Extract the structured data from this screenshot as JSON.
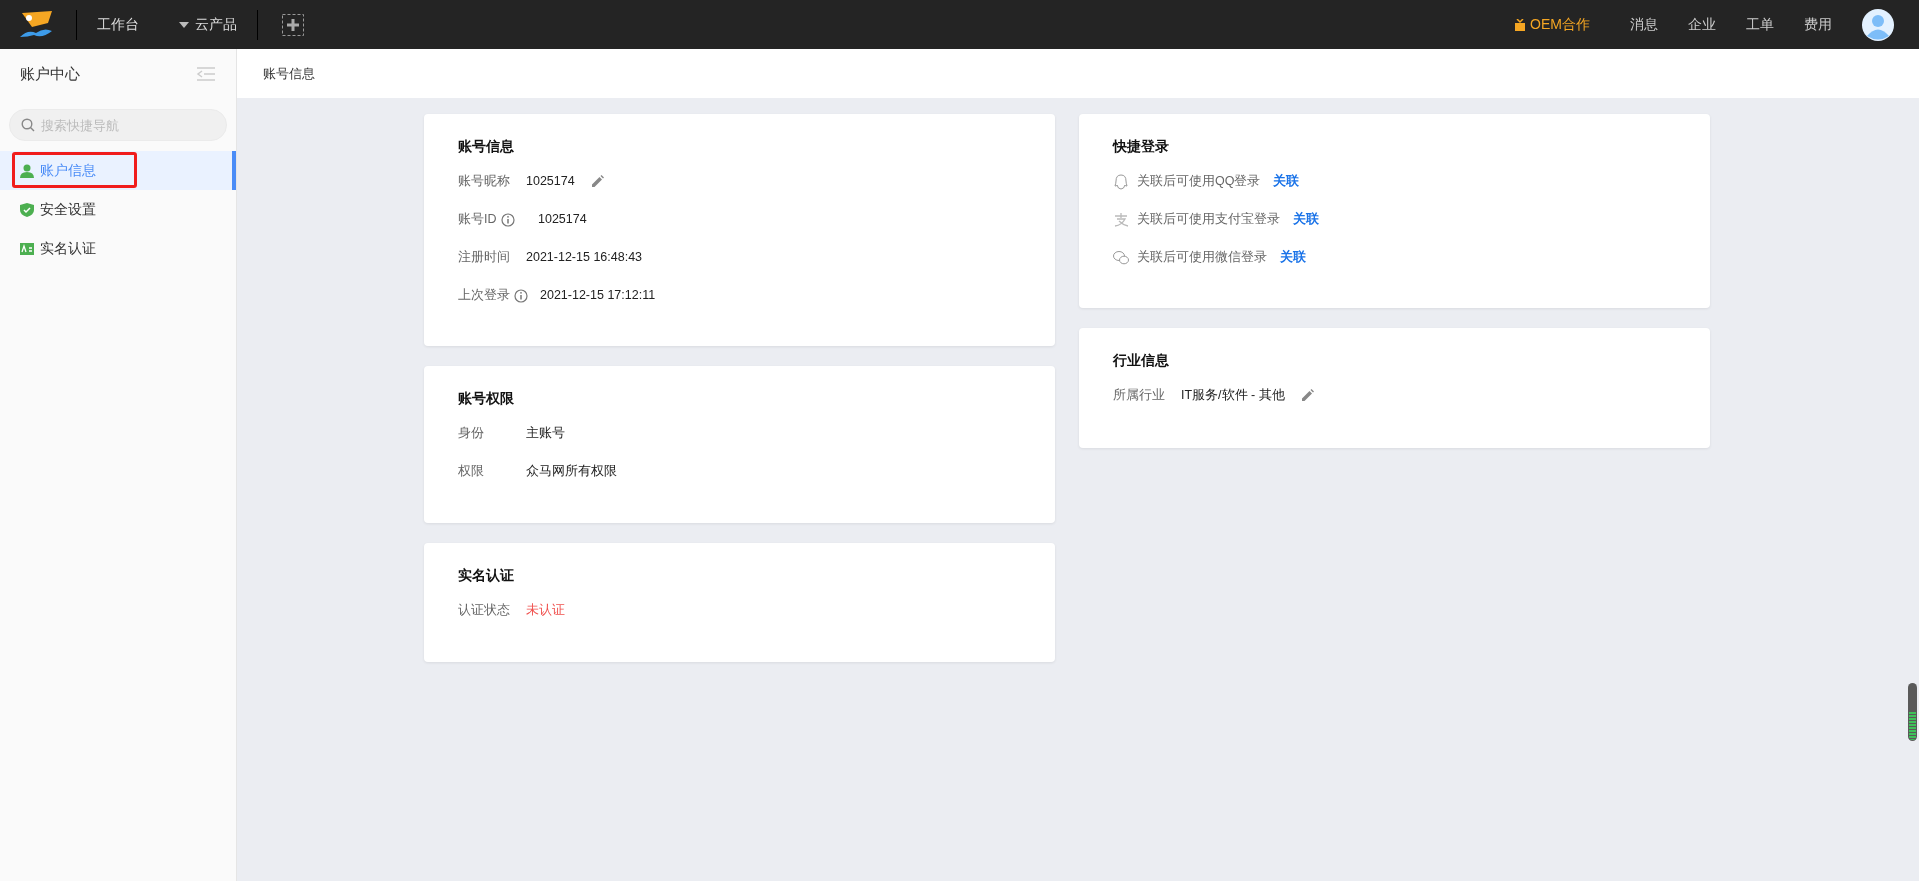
{
  "topbar": {
    "nav": [
      {
        "label": "工作台",
        "kind": "link"
      },
      {
        "label": "云产品",
        "kind": "dropdown"
      }
    ],
    "actions": [
      {
        "label": "OEM合作",
        "kind": "promo"
      },
      {
        "label": "消息",
        "kind": "link"
      },
      {
        "label": "企业",
        "kind": "link"
      },
      {
        "label": "工单",
        "kind": "link"
      },
      {
        "label": "费用",
        "kind": "link"
      }
    ]
  },
  "sidebar": {
    "title": "账户中心",
    "search": {
      "placeholder": "搜索快捷导航"
    },
    "items": [
      {
        "label": "账户信息",
        "selected": true,
        "highlighted": true
      },
      {
        "label": "安全设置",
        "selected": false,
        "highlighted": false
      },
      {
        "label": "实名认证",
        "selected": false,
        "highlighted": false
      }
    ]
  },
  "breadcrumb": "账号信息",
  "columns": [
    [
      {
        "title": "账号信息",
        "rows": [
          {
            "kind": "field",
            "label": "账号昵称",
            "info": false,
            "value": "1025174",
            "editable": true
          },
          {
            "kind": "field",
            "label": "账号ID",
            "info": true,
            "value": "1025174",
            "editable": false
          },
          {
            "kind": "field",
            "label": "注册时间",
            "info": false,
            "value": "2021-12-15 16:48:43",
            "editable": false
          },
          {
            "kind": "field",
            "label": "上次登录",
            "info": true,
            "value": "2021-12-15 17:12:11",
            "editable": false
          }
        ]
      },
      {
        "title": "账号权限",
        "rows": [
          {
            "kind": "field",
            "label": "身份",
            "info": false,
            "value": "主账号",
            "editable": false
          },
          {
            "kind": "field",
            "label": "权限",
            "info": false,
            "value": "众马网所有权限",
            "editable": false
          }
        ]
      },
      {
        "title": "实名认证",
        "rows": [
          {
            "kind": "status",
            "label": "认证状态",
            "info": false,
            "value": "未认证",
            "editable": false
          }
        ]
      }
    ],
    [
      {
        "title": "快捷登录",
        "rows": [
          {
            "kind": "bind",
            "text": "关联后可使用QQ登录",
            "link": "关联"
          },
          {
            "kind": "bind",
            "text": "关联后可使用支付宝登录",
            "link": "关联"
          },
          {
            "kind": "bind",
            "text": "关联后可使用微信登录",
            "link": "关联"
          }
        ]
      },
      {
        "title": "行业信息",
        "rows": [
          {
            "kind": "field",
            "label": "所属行业",
            "info": false,
            "value": "IT服务/软件 - 其他",
            "editable": true
          }
        ]
      }
    ]
  ]
}
